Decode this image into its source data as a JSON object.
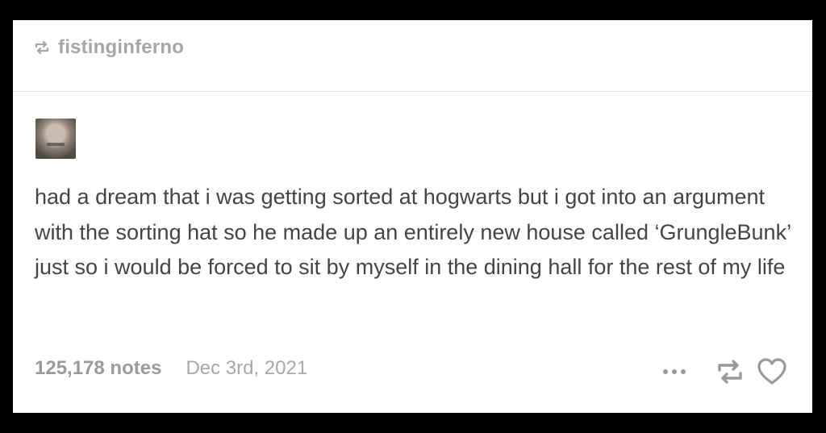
{
  "header": {
    "reblog_icon": "reblog-icon",
    "blog_name": "fistinginferno"
  },
  "post": {
    "avatar": "avatar",
    "text": "had a dream that i was getting sorted at hogwarts but i got into an argument with the sorting hat so he made up an entirely new house called ‘GrungleBunk’ just so i would be forced to sit by myself in the dining hall for the rest of my life"
  },
  "footer": {
    "notes": "125,178 notes",
    "date": "Dec 3rd, 2021",
    "icons": [
      "more-icon",
      "reblog-icon",
      "heart-icon"
    ]
  },
  "colors": {
    "background": "#000000",
    "card": "#ffffff",
    "text": "#444444",
    "muted": "#9a9a9a"
  }
}
